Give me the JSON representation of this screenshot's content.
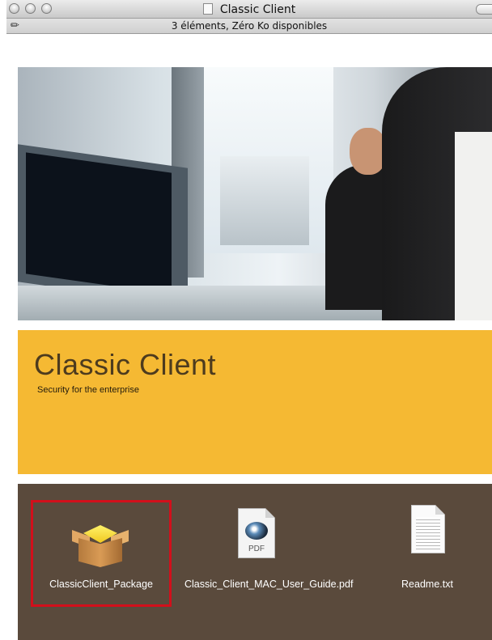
{
  "window": {
    "title": "Classic Client",
    "status": "3 éléments, Zéro Ko disponibles"
  },
  "banner": {
    "title": "Classic Client",
    "subtitle": "Security for the enterprise"
  },
  "files": [
    {
      "label": "ClassicClient_Package",
      "icon": "package-icon",
      "selected": true
    },
    {
      "label": "Classic_Client_MAC_User_Guide.pdf",
      "icon": "pdf-icon",
      "selected": false
    },
    {
      "label": "Readme.txt",
      "icon": "text-file-icon",
      "selected": false
    }
  ],
  "colors": {
    "banner": "#f5b933",
    "files_background": "#5a4a3c",
    "selection": "#d20f1b"
  }
}
